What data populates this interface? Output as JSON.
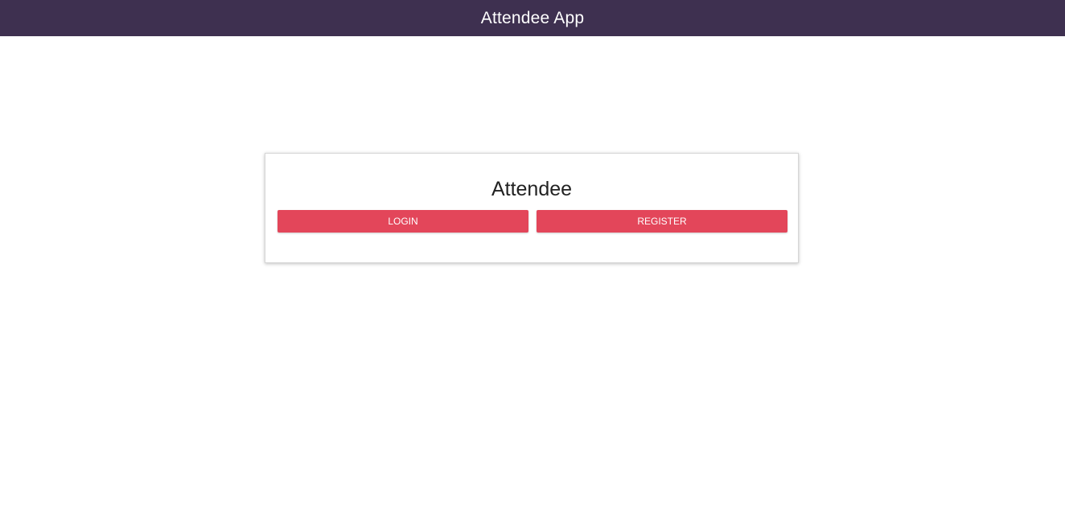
{
  "header": {
    "title": "Attendee App",
    "background_color": "#3e3050"
  },
  "card": {
    "title": "Attendee",
    "login_label": "LOGIN",
    "register_label": "REGISTER",
    "button_color": "#e3465a"
  }
}
